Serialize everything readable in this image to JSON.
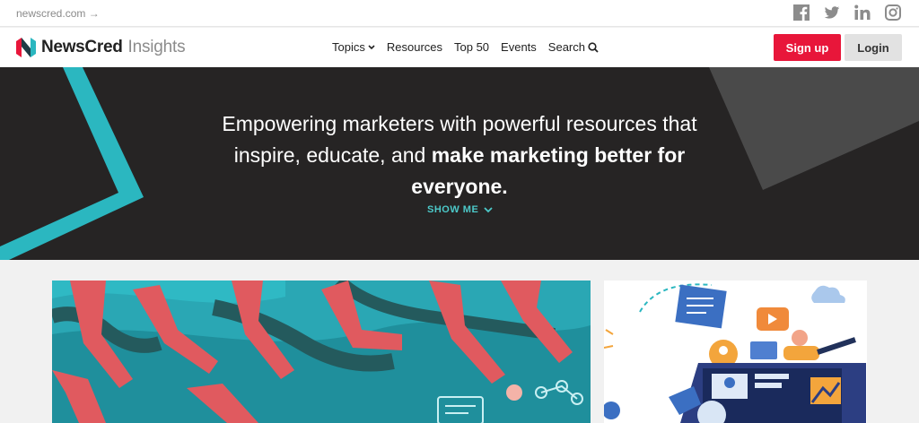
{
  "topbar": {
    "site_link": "newscred.com →",
    "social": [
      "facebook-icon",
      "twitter-icon",
      "linkedin-icon",
      "instagram-icon"
    ]
  },
  "nav": {
    "logo_name": "NewsCred",
    "logo_sub": "Insights",
    "items": [
      {
        "label": "Topics",
        "has_dropdown": true
      },
      {
        "label": "Resources"
      },
      {
        "label": "Top 50"
      },
      {
        "label": "Events"
      },
      {
        "label": "Search",
        "icon": "search-icon"
      }
    ],
    "signup_label": "Sign up",
    "login_label": "Login"
  },
  "hero": {
    "line1": "Empowering marketers with powerful resources that",
    "line2_plain": "inspire, educate, and ",
    "line2_bold": "make marketing better for",
    "line3_bold": "everyone.",
    "show_me": "SHOW ME"
  },
  "colors": {
    "accent_red": "#e8163a",
    "accent_teal": "#4cc9c9",
    "hero_bg": "#262424"
  }
}
